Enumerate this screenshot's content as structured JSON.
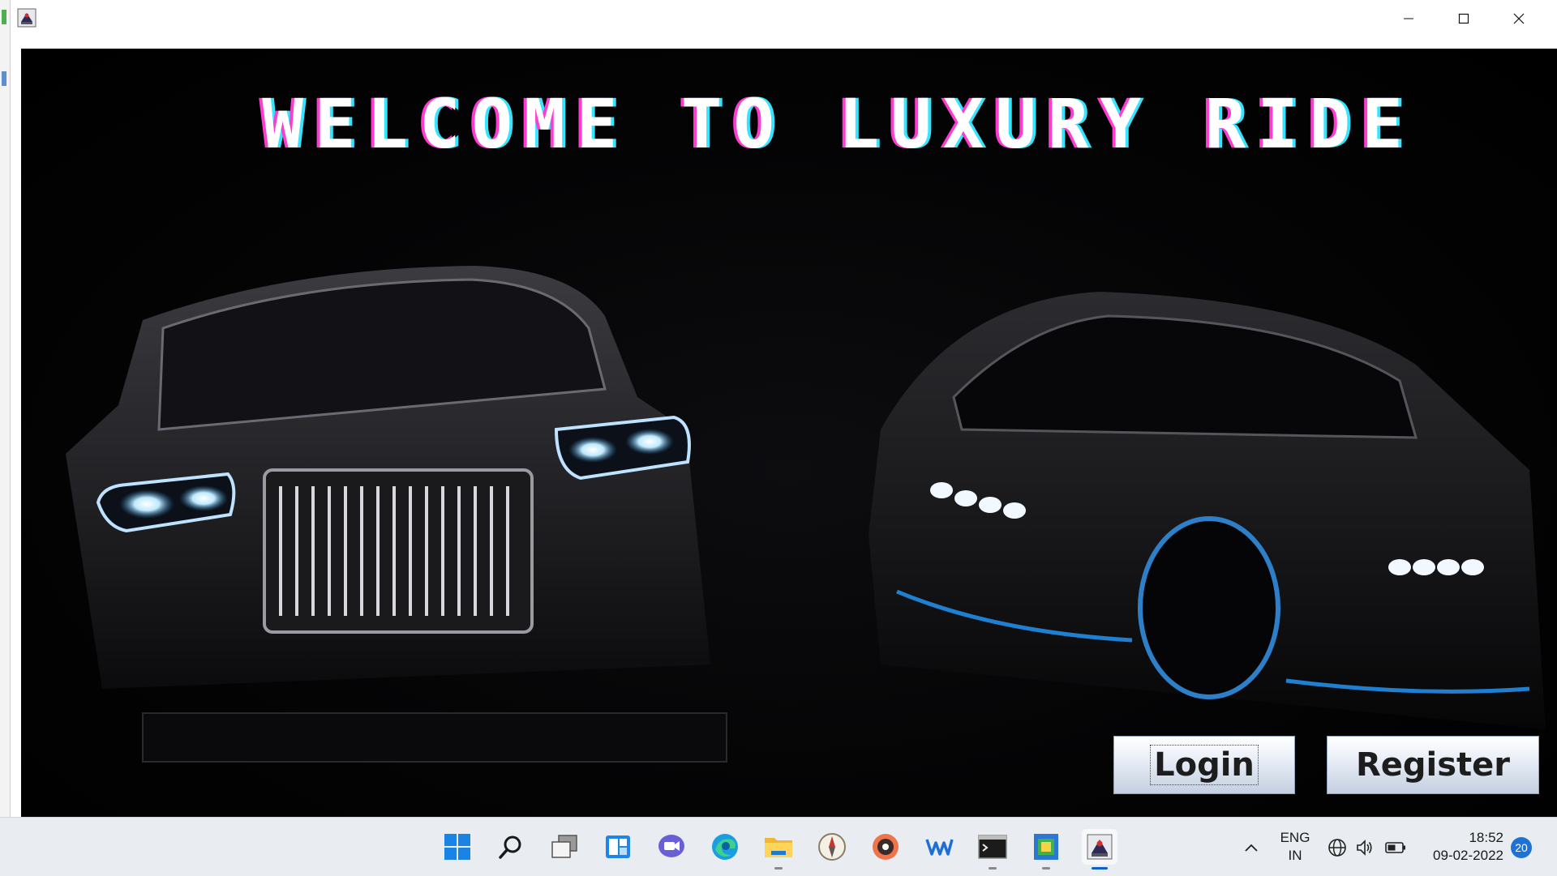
{
  "window": {
    "icon": "java-cup-icon",
    "controls": [
      "minimize-icon",
      "maximize-icon",
      "close-icon"
    ]
  },
  "content": {
    "headline": "WELCOME TO LUXURY RIDE",
    "login_label": "Login",
    "register_label": "Register",
    "background_image": "two luxury cars with glowing headlights",
    "colors": {
      "headline_left_glow": "#ff3bd0",
      "headline_right_glow": "#34e5ff",
      "background": "#000000"
    }
  },
  "taskbar": {
    "apps": [
      {
        "name": "start-icon"
      },
      {
        "name": "search-icon"
      },
      {
        "name": "task-view-icon"
      },
      {
        "name": "widgets-icon"
      },
      {
        "name": "chat-icon"
      },
      {
        "name": "edge-icon"
      },
      {
        "name": "file-explorer-icon"
      },
      {
        "name": "compass-app-icon"
      },
      {
        "name": "media-player-icon"
      },
      {
        "name": "wave-app-icon"
      },
      {
        "name": "terminal-icon"
      },
      {
        "name": "notepad-icon"
      },
      {
        "name": "java-app-icon"
      }
    ],
    "tray": {
      "language": "ENG",
      "region": "IN",
      "time": "18:52",
      "date": "09-02-2022",
      "notifications": "20"
    }
  }
}
